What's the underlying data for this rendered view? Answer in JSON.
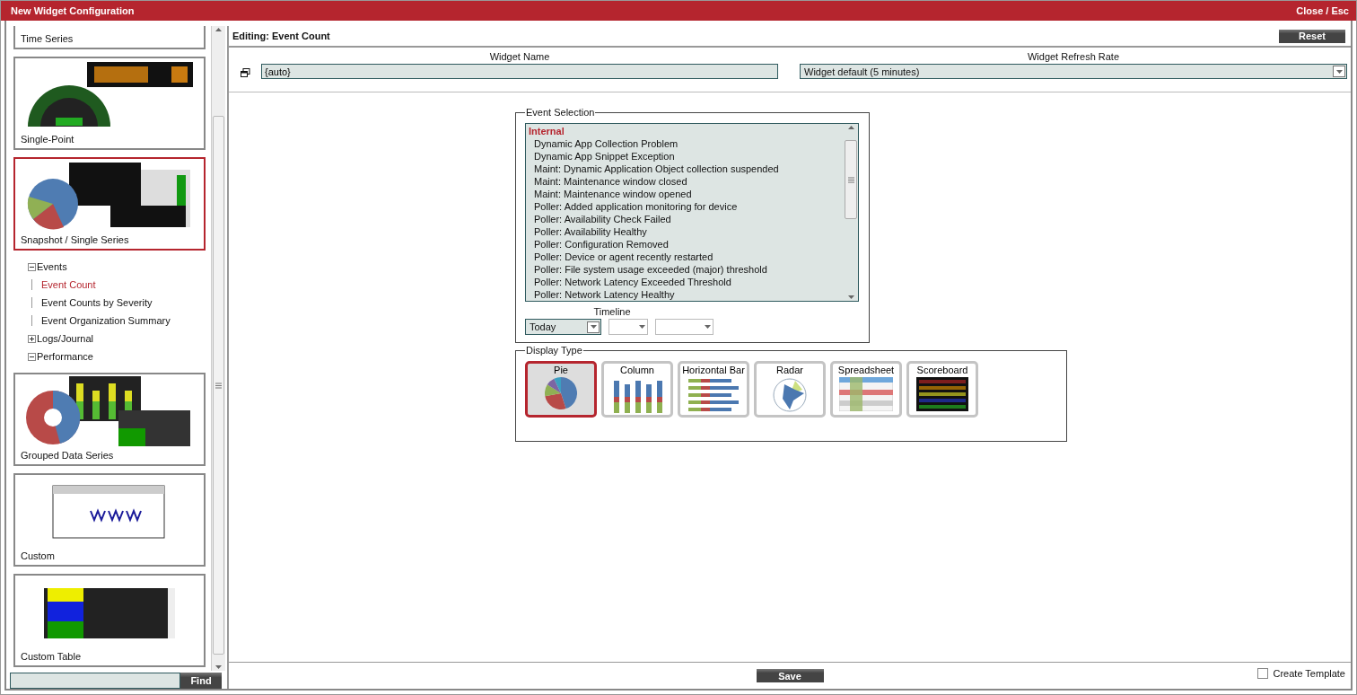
{
  "window": {
    "title": "New Widget Configuration",
    "close_label": "Close / Esc"
  },
  "sidebar": {
    "items": [
      {
        "kind": "timeseries",
        "label": "Time Series",
        "selected": false
      },
      {
        "kind": "gauge",
        "label": "Single-Point",
        "selected": false
      },
      {
        "kind": "snapshot",
        "label": "Snapshot / Single Series",
        "selected": true
      },
      {
        "kind": "group",
        "label": "Events",
        "expanded": true,
        "children": [
          {
            "label": "Event Count",
            "selected": true
          },
          {
            "label": "Event Counts by Severity",
            "selected": false
          },
          {
            "label": "Event Organization Summary",
            "selected": false
          }
        ]
      },
      {
        "kind": "group",
        "label": "Logs/Journal",
        "expanded": false
      },
      {
        "kind": "group",
        "label": "Performance",
        "expanded": true
      },
      {
        "kind": "grouped",
        "label": "Grouped Data Series",
        "selected": false
      },
      {
        "kind": "webpage",
        "label": "Custom",
        "selected": false
      },
      {
        "kind": "table",
        "label": "Custom Table",
        "selected": false
      }
    ],
    "find_button": "Find"
  },
  "editor": {
    "heading": "Editing: Event Count",
    "reset_button": "Reset",
    "widget_name": {
      "label": "Widget Name",
      "value": "{auto}"
    },
    "refresh_rate": {
      "label": "Widget Refresh Rate",
      "value": "Widget default (5 minutes)"
    },
    "event_selection": {
      "legend": "Event Selection",
      "group_heading": "Internal",
      "options": [
        "Dynamic App Collection Problem",
        "Dynamic App Snippet Exception",
        "Maint: Dynamic Application Object collection suspended",
        "Maint: Maintenance window closed",
        "Maint: Maintenance window opened",
        "Poller: Added application monitoring for device",
        "Poller: Availability Check Failed",
        "Poller: Availability Healthy",
        "Poller: Configuration Removed",
        "Poller: Device or agent recently restarted",
        "Poller: File system usage exceeded (major) threshold",
        "Poller: Network Latency Exceeded Threshold",
        "Poller: Network Latency Healthy"
      ],
      "timeline": {
        "label": "Timeline",
        "value": "Today"
      }
    },
    "display_type": {
      "legend": "Display Type",
      "options": [
        {
          "label": "Pie",
          "kind": "pie",
          "selected": true
        },
        {
          "label": "Column",
          "kind": "column",
          "selected": false
        },
        {
          "label": "Horizontal Bar",
          "kind": "bar",
          "selected": false
        },
        {
          "label": "Radar",
          "kind": "radar",
          "selected": false
        },
        {
          "label": "Spreadsheet",
          "kind": "spreadsheet",
          "selected": false
        },
        {
          "label": "Scoreboard",
          "kind": "scoreboard",
          "selected": false
        }
      ]
    },
    "save_button": "Save",
    "create_template": {
      "label": "Create Template",
      "checked": false
    }
  }
}
